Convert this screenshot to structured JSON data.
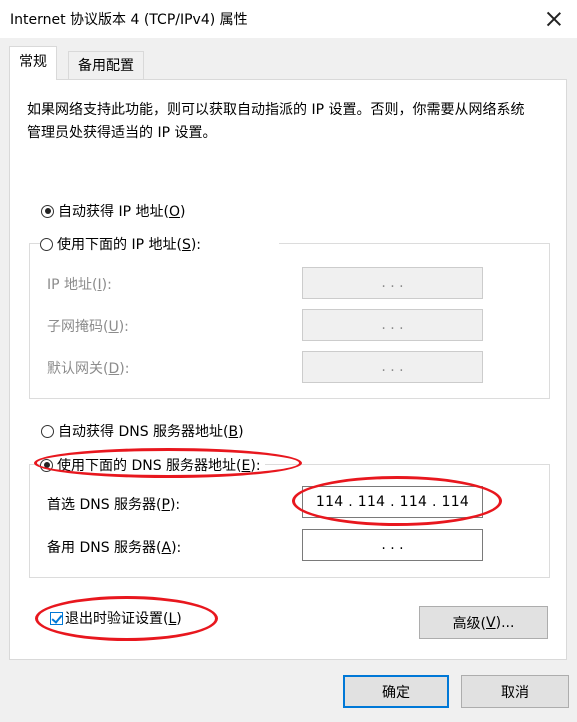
{
  "window": {
    "title": "Internet 协议版本 4 (TCP/IPv4) 属性"
  },
  "tabs": [
    {
      "label": "常规"
    },
    {
      "label": "备用配置"
    }
  ],
  "description": "如果网络支持此功能，则可以获取自动指派的 IP 设置。否则，你需要从网络系统管理员处获得适当的 IP 设置。",
  "ip": {
    "auto_label": "自动获得 IP 地址(",
    "auto_key": "O",
    "manual_label": "使用下面的 IP 地址(",
    "manual_key": "S",
    "selected": "auto",
    "fields": [
      {
        "label": "IP 地址(",
        "key": "I",
        "value": ".  .  ."
      },
      {
        "label": "子网掩码(",
        "key": "U",
        "value": ".  .  ."
      },
      {
        "label": "默认网关(",
        "key": "D",
        "value": ".  .  ."
      }
    ]
  },
  "dns": {
    "auto_label": "自动获得 DNS 服务器地址(",
    "auto_key": "B",
    "manual_label": "使用下面的 DNS 服务器地址(",
    "manual_key": "E",
    "selected": "manual",
    "preferred_label": "首选 DNS 服务器(",
    "preferred_key": "P",
    "preferred_value": "114 . 114 . 114 . 114",
    "alternate_label": "备用 DNS 服务器(",
    "alternate_key": "A",
    "alternate_value": ".  .  ."
  },
  "validate": {
    "label": "退出时验证设置(",
    "key": "L",
    "checked": true
  },
  "buttons": {
    "advanced_label": "高级(",
    "advanced_key": "V",
    "ok": "确定",
    "cancel": "取消"
  },
  "colors": {
    "highlight_ring": "#e8171e",
    "focus_border": "#0078d7"
  },
  "icons": {
    "close": "close-icon",
    "radio": "radio-icon",
    "checkbox": "checkbox-icon"
  }
}
